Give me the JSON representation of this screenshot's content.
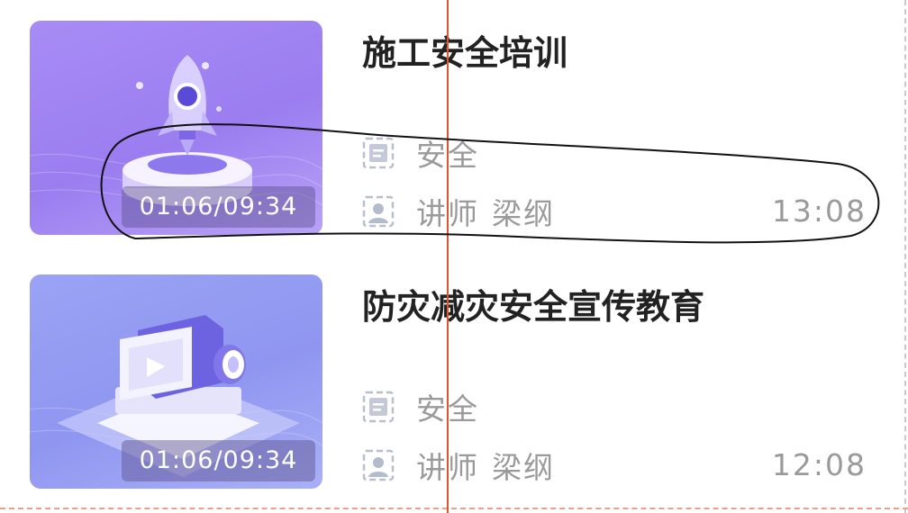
{
  "courses": [
    {
      "title": "施工安全培训",
      "duration": "01:06/09:34",
      "category": "安全",
      "teacher_label": "讲师",
      "teacher_name": "梁纲",
      "time": "13:08",
      "thumb_color": "#a88cf5",
      "thumb_icon": "rocket-illustration"
    },
    {
      "title": "防灾减灾安全宣传教育",
      "duration": "01:06/09:34",
      "category": "安全",
      "teacher_label": "讲师",
      "teacher_name": "梁纲",
      "time": "12:08",
      "thumb_color": "#9aa3f4",
      "thumb_icon": "video-camera-illustration"
    }
  ],
  "icons": {
    "category": "document-icon",
    "teacher": "user-icon"
  },
  "annotation_colors": {
    "guide_line": "#e0552e",
    "ink": "#111111"
  }
}
